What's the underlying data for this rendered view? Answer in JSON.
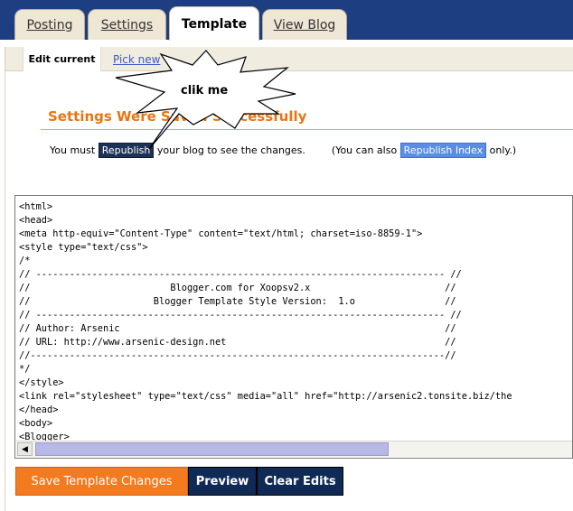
{
  "tabs": {
    "posting": "Posting",
    "settings": "Settings",
    "template": "Template",
    "view_blog": "View Blog"
  },
  "subtabs": {
    "edit_current": "Edit current",
    "pick_new": "Pick new"
  },
  "callout": "clik me",
  "status": {
    "message": "Settings Were Saved Successfully",
    "you_must": "You must",
    "republish": "Republish",
    "after_republish": "your blog to see the changes.",
    "you_can_also": "(You can also",
    "republish_index": "Republish Index",
    "only": "only.)"
  },
  "editor": {
    "code": "<html>\n<head>\n<meta http-equiv=\"Content-Type\" content=\"text/html; charset=iso-8859-1\">\n<style type=\"text/css\">\n/*\n// ------------------------------------------------------------------------- //\n//                         Blogger.com for Xoopsv2.x                        //\n//                      Blogger Template Style Version:  1.o                //\n// ------------------------------------------------------------------------- //\n// Author: Arsenic                                                          //\n// URL: http://www.arsenic-design.net                                       //\n//--------------------------------------------------------------------------//\n*/\n</style>\n<link rel=\"stylesheet\" type=\"text/css\" media=\"all\" href=\"http://arsenic2.tonsite.biz/the\n</head>\n<body>\n<Blogger>"
  },
  "actions": {
    "save": "Save Template Changes",
    "preview": "Preview",
    "clear": "Clear Edits"
  },
  "icons": {
    "scroll_left": "left-arrow-icon"
  },
  "colors": {
    "topbar": "#1d3e80",
    "accent_orange": "#f47a1f",
    "navy_button": "#0f2b55"
  }
}
